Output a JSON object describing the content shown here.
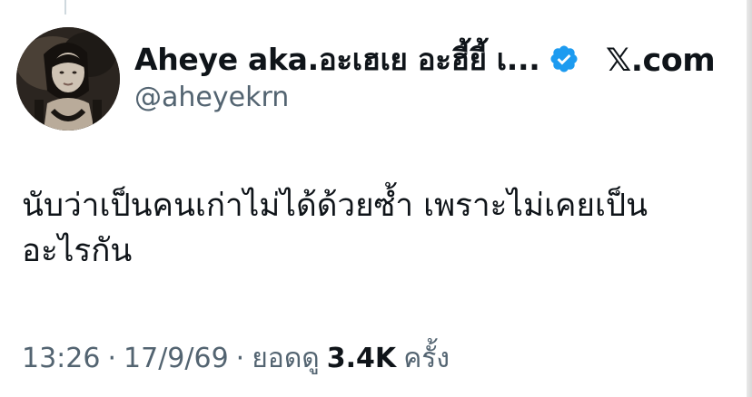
{
  "author": {
    "display_name": "Aheye aka.อะเฮเย อะฮี้ยี้ เ...",
    "handle": "@aheyekrn",
    "verified": true,
    "avatar": "profile-photo"
  },
  "brand": {
    "logo_icon": "x-logo-icon",
    "site_text": "𝕏.com"
  },
  "tweet": {
    "lines": [
      "นับว่าเป็นคนเก่าไม่ได้ด้วยซ้ำ เพราะไม่เคยเป็น",
      "อะไรกัน"
    ]
  },
  "meta": {
    "time": "13:26",
    "date": "17/9/69",
    "views_label": "ยอดดู",
    "views_count": "3.4K",
    "views_suffix": "ครั้ง",
    "separator": "·"
  },
  "colors": {
    "text_primary": "#0f1419",
    "text_secondary": "#536471",
    "verified_blue": "#1d9bf0"
  }
}
